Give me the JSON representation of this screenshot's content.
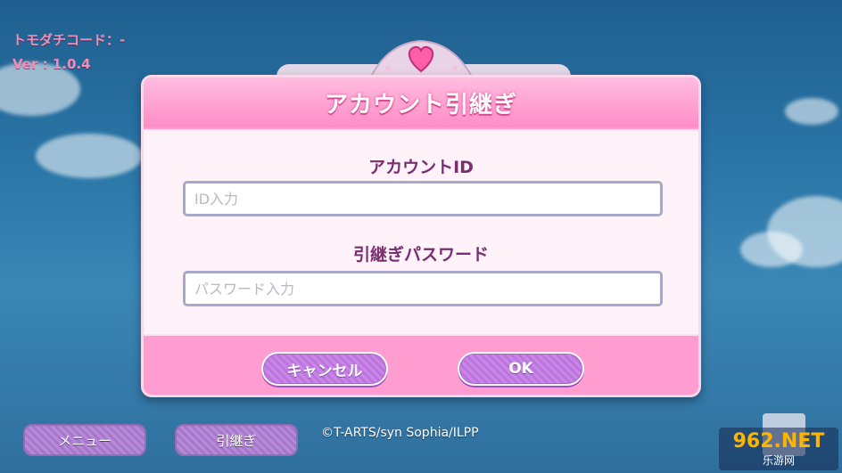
{
  "info": {
    "tomodachi_code": "トモダチコード：-",
    "version": "Ver : 1.0.4"
  },
  "dialog": {
    "title": "アカウント引継ぎ",
    "account_id_label": "アカウントID",
    "account_id_placeholder": "ID入力",
    "password_label": "引継ぎパスワード",
    "password_placeholder": "パスワード入力",
    "cancel_label": "キャンセル",
    "ok_label": "OK"
  },
  "bottom": {
    "menu_label": "メニュー",
    "transfer_label": "引継ぎ",
    "copyright": "©T-ARTS/syn Sophia/ILPP"
  },
  "watermark": {
    "main": "962.NET",
    "sub": "乐游网"
  },
  "colors": {
    "dialog_pink": "#ff9dd0",
    "label_purple": "#7a2d70",
    "button_purple": "#c986e6",
    "sky": "#2a76a7"
  }
}
